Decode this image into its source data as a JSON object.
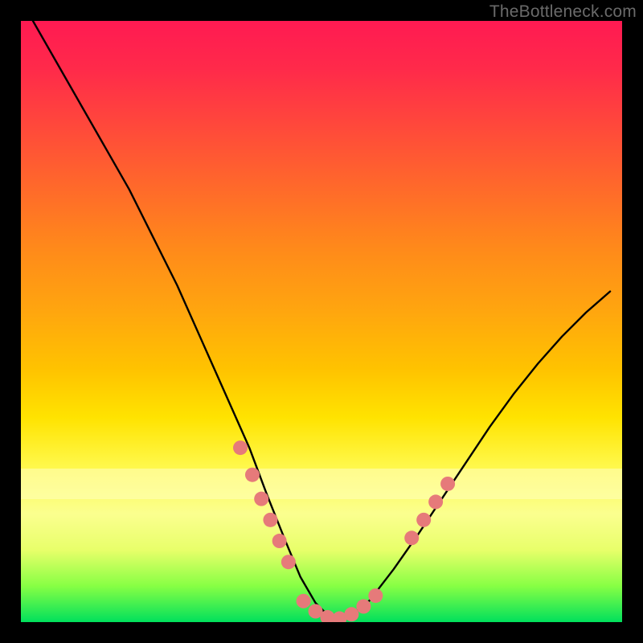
{
  "watermark": "TheBottleneck.com",
  "chart_data": {
    "type": "line",
    "title": "",
    "xlabel": "",
    "ylabel": "",
    "xlim": [
      0,
      100
    ],
    "ylim": [
      0,
      100
    ],
    "grid": false,
    "legend": false,
    "series": [
      {
        "name": "curve",
        "color": "#000000",
        "x": [
          2,
          6,
          10,
          14,
          18,
          22,
          26,
          30,
          34,
          38,
          41,
          44,
          46.5,
          49,
          51,
          53,
          55,
          58,
          62,
          66,
          70,
          74,
          78,
          82,
          86,
          90,
          94,
          98
        ],
        "y": [
          100,
          93,
          86,
          79,
          72,
          64,
          56,
          47,
          38,
          29,
          21,
          13.5,
          7.5,
          3.2,
          1.2,
          0.4,
          1.2,
          3.6,
          8.8,
          14.5,
          20.5,
          26.5,
          32.5,
          38,
          43,
          47.5,
          51.5,
          55
        ]
      },
      {
        "name": "dots-left",
        "type": "scatter",
        "color": "#e67a7a",
        "x": [
          36.5,
          38.5,
          40,
          41.5,
          43,
          44.5
        ],
        "y": [
          29,
          24.5,
          20.5,
          17,
          13.5,
          10
        ]
      },
      {
        "name": "dots-bottom",
        "type": "scatter",
        "color": "#e67a7a",
        "x": [
          47,
          49,
          51,
          53,
          55,
          57,
          59
        ],
        "y": [
          3.5,
          1.8,
          0.8,
          0.6,
          1.3,
          2.6,
          4.4
        ]
      },
      {
        "name": "dots-right",
        "type": "scatter",
        "color": "#e67a7a",
        "x": [
          65,
          67,
          69,
          71
        ],
        "y": [
          14,
          17,
          20,
          23
        ]
      }
    ],
    "background_gradient": {
      "type": "vertical",
      "stops": [
        {
          "pos": 0.0,
          "color": "#ff1a52"
        },
        {
          "pos": 0.18,
          "color": "#ff4a3a"
        },
        {
          "pos": 0.38,
          "color": "#ff8a1a"
        },
        {
          "pos": 0.58,
          "color": "#ffc300"
        },
        {
          "pos": 0.74,
          "color": "#fff84a"
        },
        {
          "pos": 0.88,
          "color": "#e8ff6a"
        },
        {
          "pos": 1.0,
          "color": "#00e05c"
        }
      ]
    },
    "highlight_band": {
      "y_from": 20,
      "y_to": 26,
      "color": "#ffffbf",
      "opacity": 0.55
    }
  }
}
